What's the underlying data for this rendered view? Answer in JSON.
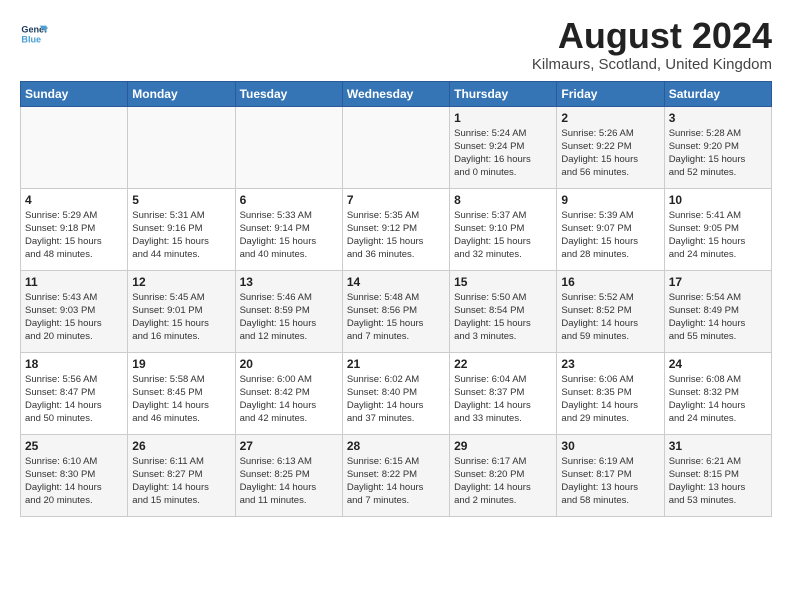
{
  "header": {
    "logo_line1": "General",
    "logo_line2": "Blue",
    "month_title": "August 2024",
    "location": "Kilmaurs, Scotland, United Kingdom"
  },
  "weekdays": [
    "Sunday",
    "Monday",
    "Tuesday",
    "Wednesday",
    "Thursday",
    "Friday",
    "Saturday"
  ],
  "weeks": [
    [
      {
        "day": "",
        "info": ""
      },
      {
        "day": "",
        "info": ""
      },
      {
        "day": "",
        "info": ""
      },
      {
        "day": "",
        "info": ""
      },
      {
        "day": "1",
        "info": "Sunrise: 5:24 AM\nSunset: 9:24 PM\nDaylight: 16 hours\nand 0 minutes."
      },
      {
        "day": "2",
        "info": "Sunrise: 5:26 AM\nSunset: 9:22 PM\nDaylight: 15 hours\nand 56 minutes."
      },
      {
        "day": "3",
        "info": "Sunrise: 5:28 AM\nSunset: 9:20 PM\nDaylight: 15 hours\nand 52 minutes."
      }
    ],
    [
      {
        "day": "4",
        "info": "Sunrise: 5:29 AM\nSunset: 9:18 PM\nDaylight: 15 hours\nand 48 minutes."
      },
      {
        "day": "5",
        "info": "Sunrise: 5:31 AM\nSunset: 9:16 PM\nDaylight: 15 hours\nand 44 minutes."
      },
      {
        "day": "6",
        "info": "Sunrise: 5:33 AM\nSunset: 9:14 PM\nDaylight: 15 hours\nand 40 minutes."
      },
      {
        "day": "7",
        "info": "Sunrise: 5:35 AM\nSunset: 9:12 PM\nDaylight: 15 hours\nand 36 minutes."
      },
      {
        "day": "8",
        "info": "Sunrise: 5:37 AM\nSunset: 9:10 PM\nDaylight: 15 hours\nand 32 minutes."
      },
      {
        "day": "9",
        "info": "Sunrise: 5:39 AM\nSunset: 9:07 PM\nDaylight: 15 hours\nand 28 minutes."
      },
      {
        "day": "10",
        "info": "Sunrise: 5:41 AM\nSunset: 9:05 PM\nDaylight: 15 hours\nand 24 minutes."
      }
    ],
    [
      {
        "day": "11",
        "info": "Sunrise: 5:43 AM\nSunset: 9:03 PM\nDaylight: 15 hours\nand 20 minutes."
      },
      {
        "day": "12",
        "info": "Sunrise: 5:45 AM\nSunset: 9:01 PM\nDaylight: 15 hours\nand 16 minutes."
      },
      {
        "day": "13",
        "info": "Sunrise: 5:46 AM\nSunset: 8:59 PM\nDaylight: 15 hours\nand 12 minutes."
      },
      {
        "day": "14",
        "info": "Sunrise: 5:48 AM\nSunset: 8:56 PM\nDaylight: 15 hours\nand 7 minutes."
      },
      {
        "day": "15",
        "info": "Sunrise: 5:50 AM\nSunset: 8:54 PM\nDaylight: 15 hours\nand 3 minutes."
      },
      {
        "day": "16",
        "info": "Sunrise: 5:52 AM\nSunset: 8:52 PM\nDaylight: 14 hours\nand 59 minutes."
      },
      {
        "day": "17",
        "info": "Sunrise: 5:54 AM\nSunset: 8:49 PM\nDaylight: 14 hours\nand 55 minutes."
      }
    ],
    [
      {
        "day": "18",
        "info": "Sunrise: 5:56 AM\nSunset: 8:47 PM\nDaylight: 14 hours\nand 50 minutes."
      },
      {
        "day": "19",
        "info": "Sunrise: 5:58 AM\nSunset: 8:45 PM\nDaylight: 14 hours\nand 46 minutes."
      },
      {
        "day": "20",
        "info": "Sunrise: 6:00 AM\nSunset: 8:42 PM\nDaylight: 14 hours\nand 42 minutes."
      },
      {
        "day": "21",
        "info": "Sunrise: 6:02 AM\nSunset: 8:40 PM\nDaylight: 14 hours\nand 37 minutes."
      },
      {
        "day": "22",
        "info": "Sunrise: 6:04 AM\nSunset: 8:37 PM\nDaylight: 14 hours\nand 33 minutes."
      },
      {
        "day": "23",
        "info": "Sunrise: 6:06 AM\nSunset: 8:35 PM\nDaylight: 14 hours\nand 29 minutes."
      },
      {
        "day": "24",
        "info": "Sunrise: 6:08 AM\nSunset: 8:32 PM\nDaylight: 14 hours\nand 24 minutes."
      }
    ],
    [
      {
        "day": "25",
        "info": "Sunrise: 6:10 AM\nSunset: 8:30 PM\nDaylight: 14 hours\nand 20 minutes."
      },
      {
        "day": "26",
        "info": "Sunrise: 6:11 AM\nSunset: 8:27 PM\nDaylight: 14 hours\nand 15 minutes."
      },
      {
        "day": "27",
        "info": "Sunrise: 6:13 AM\nSunset: 8:25 PM\nDaylight: 14 hours\nand 11 minutes."
      },
      {
        "day": "28",
        "info": "Sunrise: 6:15 AM\nSunset: 8:22 PM\nDaylight: 14 hours\nand 7 minutes."
      },
      {
        "day": "29",
        "info": "Sunrise: 6:17 AM\nSunset: 8:20 PM\nDaylight: 14 hours\nand 2 minutes."
      },
      {
        "day": "30",
        "info": "Sunrise: 6:19 AM\nSunset: 8:17 PM\nDaylight: 13 hours\nand 58 minutes."
      },
      {
        "day": "31",
        "info": "Sunrise: 6:21 AM\nSunset: 8:15 PM\nDaylight: 13 hours\nand 53 minutes."
      }
    ]
  ]
}
